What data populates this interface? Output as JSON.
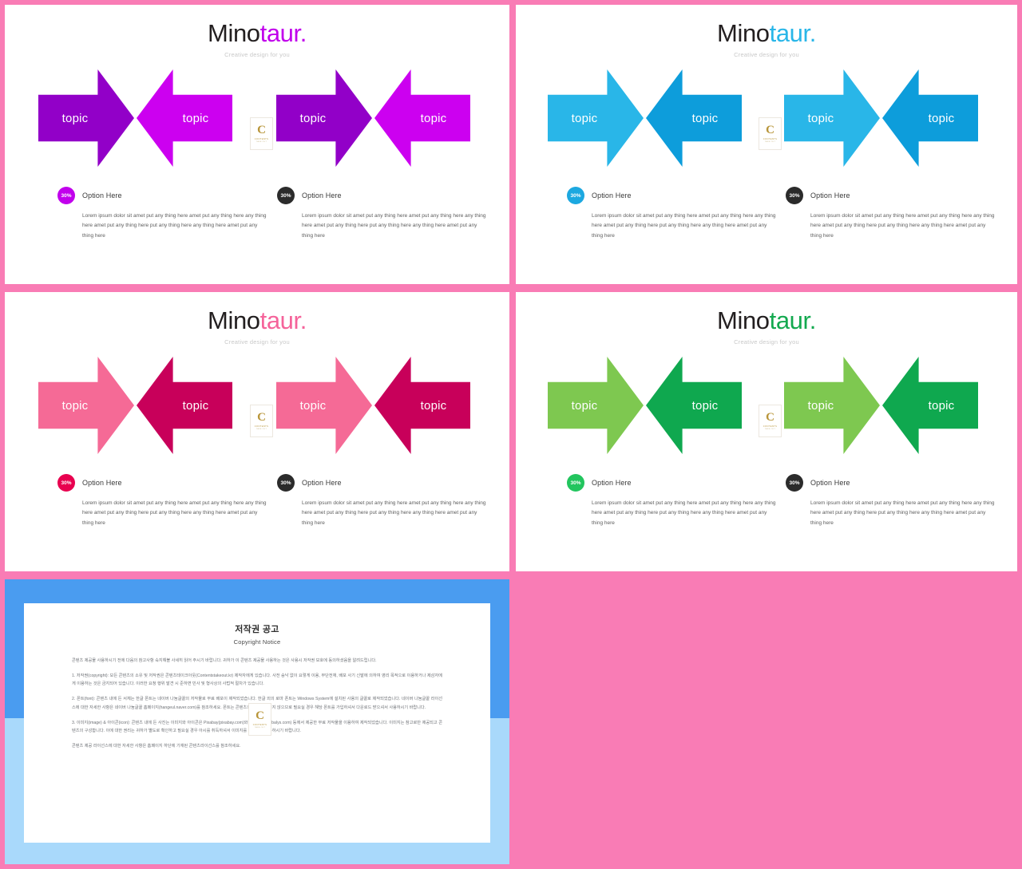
{
  "page": {
    "background_color": "#f97cb5"
  },
  "slides": [
    {
      "id": "purple",
      "brand_dark": "Mino",
      "brand_accent": "taur.",
      "tagline": "Creative design for you",
      "accent_color": "#c100ec",
      "arrow_dark": "#9200c8",
      "arrow_light": "#cc00f0",
      "arrows": [
        {
          "label": "topic",
          "direction": "right",
          "color": "#9200c8"
        },
        {
          "label": "topic",
          "direction": "left",
          "color": "#cc00f0"
        },
        {
          "label": "topic",
          "direction": "right",
          "color": "#9200c8"
        },
        {
          "label": "topic",
          "direction": "left",
          "color": "#cc00f0"
        }
      ],
      "options": [
        {
          "percent": "30%",
          "badge_color": "#c100ec",
          "title": "Option Here",
          "body": "Lorem ipsum dolor sit amet put any thing here amet put any thing here any thing here amet put any thing here put any thing here any thing here amet put any thing here"
        },
        {
          "percent": "30%",
          "badge_color": "#2b2b2b",
          "title": "Option Here",
          "body": "Lorem ipsum dolor sit amet put any thing here amet put any thing here any thing here amet put any thing here put any thing here any thing here amet put any thing here"
        }
      ]
    },
    {
      "id": "blue",
      "brand_dark": "Mino",
      "brand_accent": "taur.",
      "tagline": "Creative design for you",
      "accent_color": "#29b6e8",
      "arrow_dark": "#0d9ddb",
      "arrow_light": "#29b6e8",
      "arrows": [
        {
          "label": "topic",
          "direction": "right",
          "color": "#29b6e8"
        },
        {
          "label": "topic",
          "direction": "left",
          "color": "#0d9ddb"
        },
        {
          "label": "topic",
          "direction": "right",
          "color": "#29b6e8"
        },
        {
          "label": "topic",
          "direction": "left",
          "color": "#0d9ddb"
        }
      ],
      "options": [
        {
          "percent": "30%",
          "badge_color": "#1ca8e0",
          "title": "Option Here",
          "body": "Lorem ipsum dolor sit amet put any thing here amet put any thing here any thing here amet put any thing here put any thing here any thing here amet put any thing here"
        },
        {
          "percent": "30%",
          "badge_color": "#2b2b2b",
          "title": "Option Here",
          "body": "Lorem ipsum dolor sit amet put any thing here amet put any thing here any thing here amet put any thing here put any thing here any thing here amet put any thing here"
        }
      ]
    },
    {
      "id": "pink",
      "brand_dark": "Mino",
      "brand_accent": "taur.",
      "tagline": "Creative design for you",
      "accent_color": "#f5639a",
      "arrow_dark": "#c8005a",
      "arrow_light": "#f56a96",
      "arrows": [
        {
          "label": "topic",
          "direction": "right",
          "color": "#f56a96"
        },
        {
          "label": "topic",
          "direction": "left",
          "color": "#c8005a"
        },
        {
          "label": "topic",
          "direction": "right",
          "color": "#f56a96"
        },
        {
          "label": "topic",
          "direction": "left",
          "color": "#c8005a"
        }
      ],
      "options": [
        {
          "percent": "30%",
          "badge_color": "#e8004f",
          "title": "Option Here",
          "body": "Lorem ipsum dolor sit amet put any thing here amet put any thing here any thing here amet put any thing here put any thing here any thing here amet put any thing here"
        },
        {
          "percent": "30%",
          "badge_color": "#2b2b2b",
          "title": "Option Here",
          "body": "Lorem ipsum dolor sit amet put any thing here amet put any thing here any thing here amet put any thing here put any thing here any thing here amet put any thing here"
        }
      ]
    },
    {
      "id": "green",
      "brand_dark": "Mino",
      "brand_accent": "taur.",
      "tagline": "Creative design for you",
      "accent_color": "#13a94f",
      "arrow_dark": "#0fa84f",
      "arrow_light": "#7ec850",
      "arrows": [
        {
          "label": "topic",
          "direction": "right",
          "color": "#7ec850"
        },
        {
          "label": "topic",
          "direction": "left",
          "color": "#0fa84f"
        },
        {
          "label": "topic",
          "direction": "right",
          "color": "#7ec850"
        },
        {
          "label": "topic",
          "direction": "left",
          "color": "#0fa84f"
        }
      ],
      "options": [
        {
          "percent": "30%",
          "badge_color": "#22c55e",
          "title": "Option Here",
          "body": "Lorem ipsum dolor sit amet put any thing here amet put any thing here any thing here amet put any thing here put any thing here any thing here amet put any thing here"
        },
        {
          "percent": "30%",
          "badge_color": "#2b2b2b",
          "title": "Option Here",
          "body": "Lorem ipsum dolor sit amet put any thing here amet put any thing here any thing here amet put any thing here put any thing here any thing here amet put any thing here"
        }
      ]
    }
  ],
  "watermark": {
    "letter": "C",
    "line1": "CONTENTS",
    "line2": "TAKE  OUT"
  },
  "copyright_slide": {
    "title_ko": "저작권 공고",
    "title_en": "Copyright Notice",
    "paragraphs": [
      "콘텐츠 제공물 사용하시기 전에 다음의 참고사항 숙지해볼 사세히 읽어 주시기 바랍니다. 귀하가 이 콘텐츠 제공물 사용하는 것은 사용시 저작권 보호에 동의하셨음을 알려드립니다.",
      "1. 저작권(copyright): 모든 콘텐츠의 소유 및 저작권은 콘텐츠테이크아웃(Contentstakeout.kr) 제작자에게 있습니다. 사전 승낙 없이 요렇게 이용, 무단전재, 배포 사기 신발에 의하여 영리 목적으로 이용하거나 제삼자에게 이용하는 것은 금지되어 있습니다. 이러한 요청 행위 발견 시 준하면 민사 및 형사상의 사법적 절차가 있습니다.",
      "2. 폰트(font): 콘텐츠 내에 든 서체는 한글 폰트는 네이버 나눔글꼴의 저작물로 무료 배포이 제작되었습니다. 한글 외의 로마 폰트는 Windows System에 설치된 사용의 글꼴로 제작되었습니다. 네이버 나눔글꼴 라이선스에 대한 자세한 사항은 네이버 나눔글꼴 홈페이지(hangeul.naver.com)를 참조하세요. 폰트는 콘텐츠의 함께 제공되지 않으므로 필요실 경우 해당 폰트를 가입하셔서 다운로드 받으셔서 사용하시기 바랍니다.",
      "3. 이미지(image) & 아이콘(icon): 콘텐츠 내에 든 사진는 이미지와 아이콘은 Pixabay(pixabay.com)와 Webalys(webalys.com) 등에서 제공한 무료 저작물을 이용하여 제작되었습니다. 이미지는 참고로만 제공되고 콘텐츠의 구성합니다. 이에 대한 권리는 귀하가 별도로 확인하고 필요실 경우 아시를 취득하셔서 이미지를 변경하여 사용하시기 바랍니다.",
      "콘텐츠 제공 라이선스에 대한 자세한 사항은 홈페이지 하단에 기재된 콘텐츠라이선스를 참조하세요."
    ]
  }
}
